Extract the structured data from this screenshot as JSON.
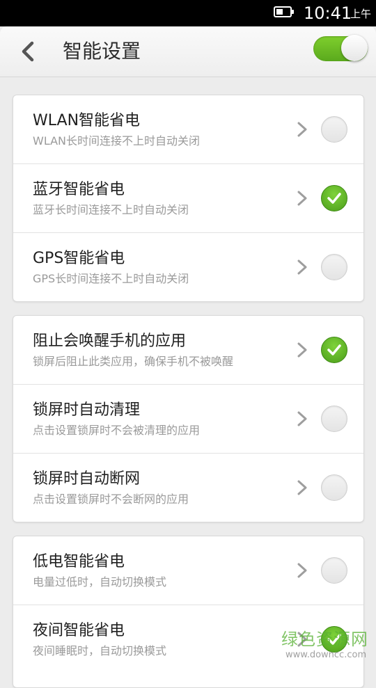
{
  "status_bar": {
    "time": "10:41",
    "ampm": "上午",
    "battery_icon": "battery-icon"
  },
  "header": {
    "back_icon": "chevron-left-icon",
    "title": "智能设置",
    "master_toggle_on": true
  },
  "groups": [
    {
      "items": [
        {
          "title": "WLAN智能省电",
          "subtitle": "WLAN长时间连接不上时自动关闭",
          "checked": false
        },
        {
          "title": "蓝牙智能省电",
          "subtitle": "蓝牙长时间连接不上时自动关闭",
          "checked": true
        },
        {
          "title": "GPS智能省电",
          "subtitle": "GPS长时间连接不上时自动关闭",
          "checked": false
        }
      ]
    },
    {
      "items": [
        {
          "title": "阻止会唤醒手机的应用",
          "subtitle": "锁屏后阻止此类应用，确保手机不被唤醒",
          "checked": true
        },
        {
          "title": "锁屏时自动清理",
          "subtitle": "点击设置锁屏时不会被清理的应用",
          "checked": false
        },
        {
          "title": "锁屏时自动断网",
          "subtitle": "点击设置锁屏时不会断网的应用",
          "checked": false
        }
      ]
    },
    {
      "items": [
        {
          "title": "低电智能省电",
          "subtitle": "电量过低时，自动切换模式",
          "checked": false
        },
        {
          "title": "夜间智能省电",
          "subtitle": "夜间睡眠时，自动切换模式",
          "checked": true
        }
      ]
    }
  ],
  "colors": {
    "accent_green": "#5aa91d",
    "background": "#ececec"
  },
  "watermark": {
    "text": "绿色资源网",
    "url": "www.downcc.com"
  }
}
